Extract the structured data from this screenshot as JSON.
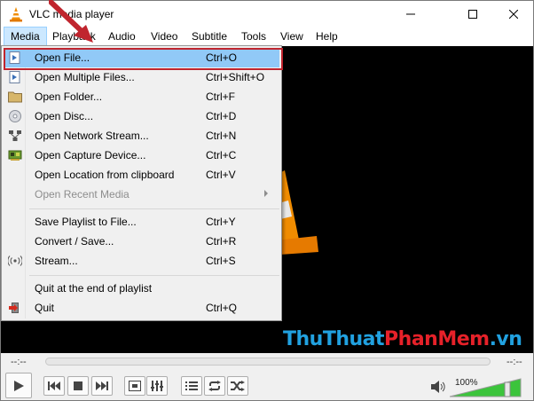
{
  "window": {
    "title": "VLC media player"
  },
  "menubar": {
    "items": [
      "Media",
      "Playback",
      "Audio",
      "Video",
      "Subtitle",
      "Tools",
      "View",
      "Help"
    ]
  },
  "media_menu": {
    "items": [
      {
        "label": "Open File...",
        "shortcut": "Ctrl+O",
        "icon": "file-play-icon",
        "highlighted": true
      },
      {
        "label": "Open Multiple Files...",
        "shortcut": "Ctrl+Shift+O",
        "icon": "multiple-files-icon"
      },
      {
        "label": "Open Folder...",
        "shortcut": "Ctrl+F",
        "icon": "folder-icon"
      },
      {
        "label": "Open Disc...",
        "shortcut": "Ctrl+D",
        "icon": "disc-icon"
      },
      {
        "label": "Open Network Stream...",
        "shortcut": "Ctrl+N",
        "icon": "network-icon"
      },
      {
        "label": "Open Capture Device...",
        "shortcut": "Ctrl+C",
        "icon": "capture-card-icon"
      },
      {
        "label": "Open Location from clipboard",
        "shortcut": "Ctrl+V",
        "icon": ""
      },
      {
        "label": "Open Recent Media",
        "shortcut": "",
        "icon": "",
        "disabled": true,
        "submenu": true
      },
      {
        "label": "Save Playlist to File...",
        "shortcut": "Ctrl+Y",
        "icon": ""
      },
      {
        "label": "Convert / Save...",
        "shortcut": "Ctrl+R",
        "icon": ""
      },
      {
        "label": "Stream...",
        "shortcut": "Ctrl+S",
        "icon": "stream-icon"
      },
      {
        "label": "Quit at the end of playlist",
        "shortcut": "",
        "icon": ""
      },
      {
        "label": "Quit",
        "shortcut": "Ctrl+Q",
        "icon": "quit-icon"
      }
    ]
  },
  "watermark": {
    "part1": "ThuThuat",
    "part2": "PhanMem",
    "part3": ".vn"
  },
  "seekbar": {
    "elapsed": "--:--",
    "remaining": "--:--"
  },
  "volume": {
    "percent_label": "100%",
    "level": 1.0
  },
  "colors": {
    "highlight": "#91c9f7",
    "callout": "#c0252e",
    "volume_green": "#3cc43c"
  }
}
